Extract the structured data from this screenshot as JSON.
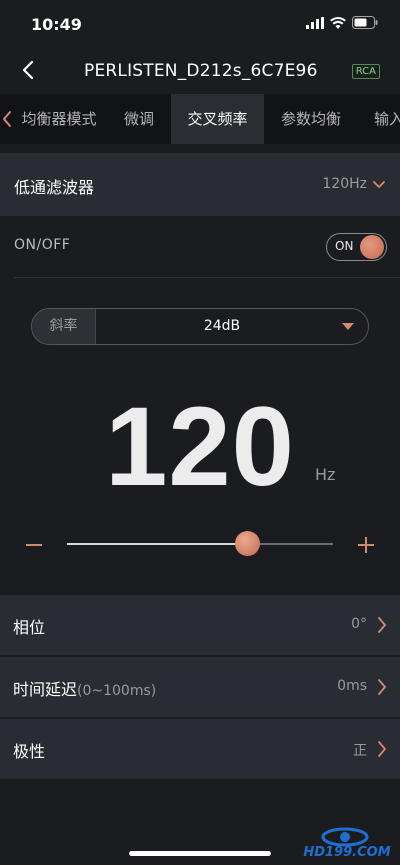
{
  "status": {
    "time": "10:49"
  },
  "nav": {
    "title": "PERLISTEN_D212s_6C7E96",
    "badge": "RCA"
  },
  "tabs": [
    {
      "label": "均衡器模式",
      "active": false
    },
    {
      "label": "微调",
      "active": false
    },
    {
      "label": "交叉频率",
      "active": true
    },
    {
      "label": "参数均衡",
      "active": false
    },
    {
      "label": "输入",
      "active": false
    }
  ],
  "lowpass": {
    "label": "低通滤波器",
    "value": "120Hz"
  },
  "power": {
    "label": "ON/OFF",
    "toggle_text": "ON",
    "enabled": true
  },
  "slope": {
    "label": "斜率",
    "value": "24dB"
  },
  "frequency": {
    "value": "120",
    "unit": "Hz",
    "slider_fraction": 0.68
  },
  "rows": [
    {
      "label": "相位",
      "hint": "",
      "value": "0°"
    },
    {
      "label": "时间延迟",
      "hint": "(0~100ms)",
      "value": "0ms"
    },
    {
      "label": "极性",
      "hint": "",
      "value": "正"
    }
  ],
  "watermark": {
    "text": "HD199.COM"
  },
  "colors": {
    "accent": "#d48a70",
    "panel": "#2a2c33",
    "background": "#1b1c20",
    "tab_bar": "#121316"
  }
}
